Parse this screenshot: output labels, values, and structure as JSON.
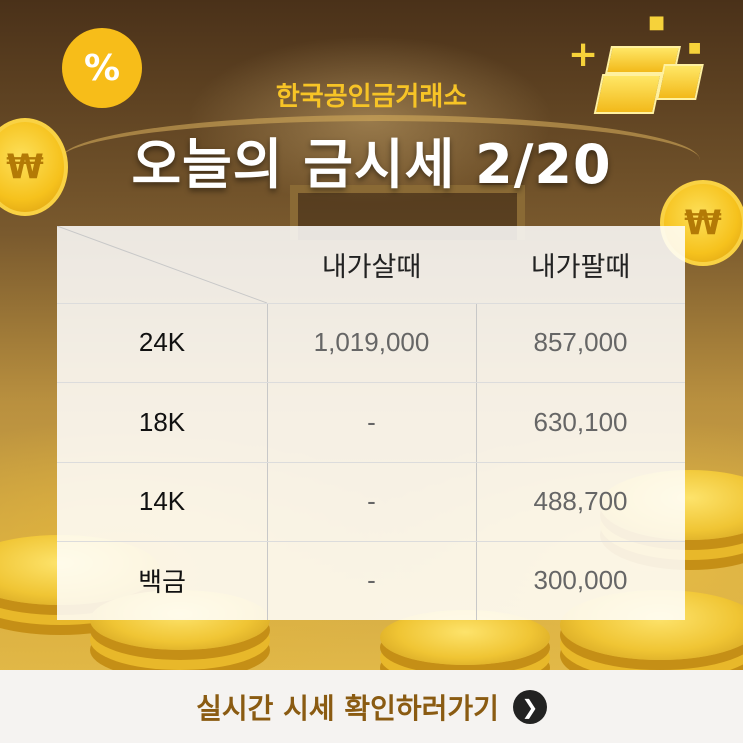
{
  "header": {
    "brand": "한국공인금거래소",
    "title": "오늘의 금시세 2/20",
    "percent_symbol": "%",
    "coin_symbol": "₩"
  },
  "table": {
    "columns": [
      "내가살때",
      "내가팔때"
    ],
    "rows": [
      {
        "label": "24K",
        "buy": "1,019,000",
        "sell": "857,000"
      },
      {
        "label": "18K",
        "buy": "-",
        "sell": "630,100"
      },
      {
        "label": "14K",
        "buy": "-",
        "sell": "488,700"
      },
      {
        "label": "백금",
        "buy": "-",
        "sell": "300,000"
      }
    ]
  },
  "footer": {
    "link_label": "실시간 시세 확인하러가기",
    "arrow_icon": "chevron-right-icon"
  },
  "colors": {
    "accent_gold": "#f7c426",
    "footer_text": "#8a5b12",
    "badge": "#f7bd19"
  }
}
